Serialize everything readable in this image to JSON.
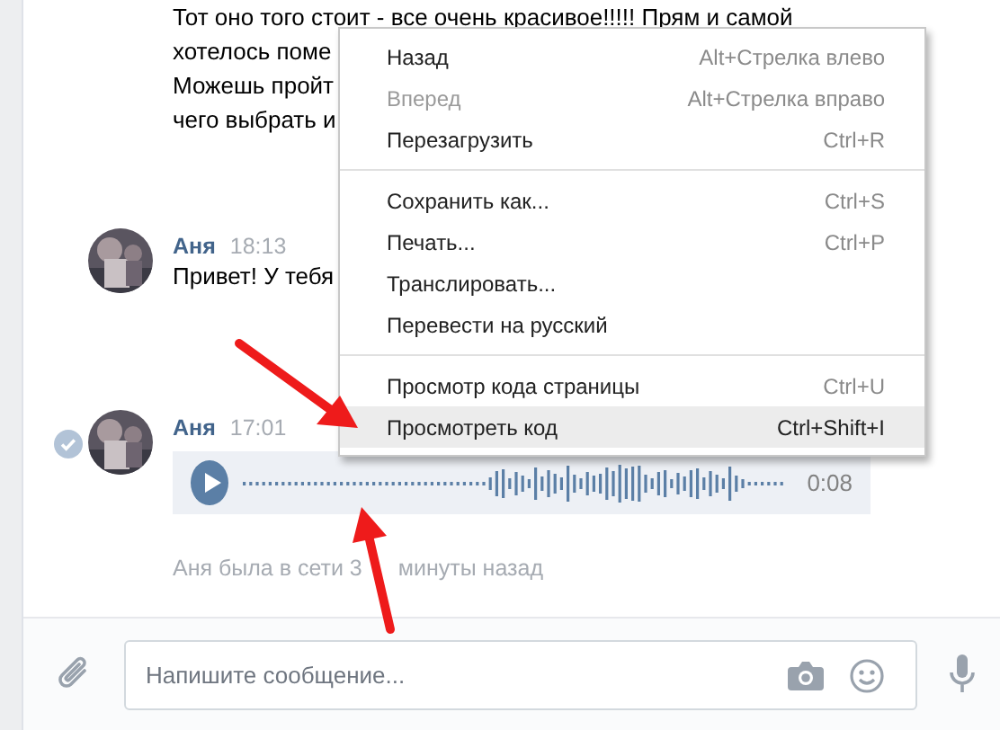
{
  "messages": [
    {
      "kind": "text",
      "unread": false,
      "lines": [
        "Тот оно того стоит - все очень красивое!!!!! Прям и самой",
        "хотелось поме",
        "Можешь пройт",
        "чего выбрать и"
      ]
    },
    {
      "kind": "text",
      "author": "Аня",
      "time": "18:13",
      "unread": false,
      "lines": [
        "Привет! У тебя"
      ]
    },
    {
      "kind": "audio",
      "author": "Аня",
      "time": "17:01",
      "unread": true,
      "duration": "0:08"
    }
  ],
  "status_parts": [
    "Аня была в сети 3",
    "минуты назад"
  ],
  "composer": {
    "placeholder": "Напишите сообщение..."
  },
  "context_menu": {
    "sections": [
      [
        {
          "label": "Назад",
          "shortcut": "Alt+Стрелка влево",
          "disabled": false,
          "selected": false
        },
        {
          "label": "Вперед",
          "shortcut": "Alt+Стрелка вправо",
          "disabled": true,
          "selected": false
        },
        {
          "label": "Перезагрузить",
          "shortcut": "Ctrl+R",
          "disabled": false,
          "selected": false
        }
      ],
      [
        {
          "label": "Сохранить как...",
          "shortcut": "Ctrl+S",
          "disabled": false,
          "selected": false
        },
        {
          "label": "Печать...",
          "shortcut": "Ctrl+P",
          "disabled": false,
          "selected": false
        },
        {
          "label": "Транслировать...",
          "disabled": false,
          "selected": false
        },
        {
          "label": "Перевести на русский",
          "disabled": false,
          "selected": false
        }
      ],
      [
        {
          "label": "Просмотр кода страницы",
          "shortcut": "Ctrl+U",
          "disabled": false,
          "selected": false
        },
        {
          "label": "Просмотреть код",
          "shortcut": "Ctrl+Shift+I",
          "disabled": false,
          "selected": true
        }
      ]
    ]
  }
}
